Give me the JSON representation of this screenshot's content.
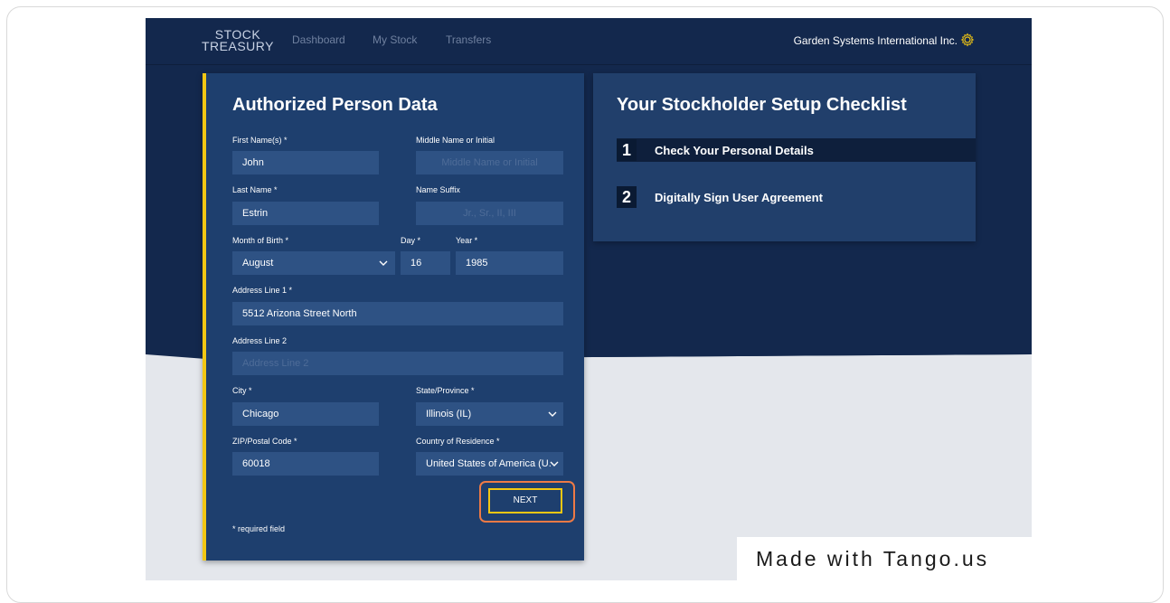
{
  "header": {
    "logo_line1": "STOCK",
    "logo_line2": "TREASURY",
    "nav": [
      "Dashboard",
      "My Stock",
      "Transfers"
    ],
    "company": "Garden Systems International Inc.",
    "gear_icon": "gear-icon"
  },
  "form": {
    "title": "Authorized Person Data",
    "first_name": {
      "label": "First Name(s) *",
      "value": "John"
    },
    "middle_name": {
      "label": "Middle Name or Initial",
      "placeholder": "Middle Name or Initial"
    },
    "last_name": {
      "label": "Last Name *",
      "value": "Estrin"
    },
    "suffix": {
      "label": "Name Suffix",
      "placeholder": "Jr., Sr., II, III"
    },
    "month": {
      "label": "Month of Birth *",
      "value": "August"
    },
    "day": {
      "label": "Day *",
      "value": "16"
    },
    "year": {
      "label": "Year *",
      "value": "1985"
    },
    "address1": {
      "label": "Address Line 1 *",
      "value": "5512 Arizona Street North"
    },
    "address2": {
      "label": "Address Line 2",
      "placeholder": "Address Line 2"
    },
    "city": {
      "label": "City *",
      "value": "Chicago"
    },
    "state": {
      "label": "State/Province *",
      "value": "Illinois (IL)"
    },
    "zip": {
      "label": "ZIP/Postal Code *",
      "value": "60018"
    },
    "country": {
      "label": "Country of Residence *",
      "value": "United States of America (U."
    },
    "next_label": "NEXT",
    "required_note": "* required field"
  },
  "checklist": {
    "title": "Your Stockholder Setup Checklist",
    "steps": [
      {
        "num": "1",
        "label": "Check Your Personal Details"
      },
      {
        "num": "2",
        "label": "Digitally Sign User Agreement"
      }
    ]
  },
  "watermark": "Made with Tango.us",
  "colors": {
    "accent_yellow": "#f2c713",
    "highlight_orange": "#ee7a45",
    "navy": "#13284d"
  }
}
